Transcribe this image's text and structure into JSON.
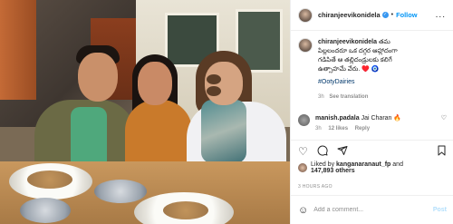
{
  "post": {
    "username": "chiranjeevikonidela",
    "follow_label": "Follow",
    "separator": "•",
    "more_label": "...",
    "caption": {
      "username": "chiranjeevikonidela",
      "line1": "తమ",
      "line2": "పిల్లలందరూ ఒక దగ్గర ఆహ్లాదంగా",
      "line3": "గడిపితే ఆ తల్లిదండ్రులకు కలిగే",
      "line4": "ఉత్సాహమే వేరు.",
      "emojis": "♥️ 🧿",
      "hashtag": "#OotyDairies",
      "time": "3h",
      "see_translation": "See translation"
    },
    "comment": {
      "username": "manish.padala",
      "text": "Jai Charan",
      "emoji": "🔥",
      "time": "3h",
      "likes": "12 likes",
      "reply": "Reply"
    },
    "icons": {
      "like": "heart-icon",
      "comment": "comment-icon",
      "share": "share-icon",
      "save": "bookmark-icon"
    },
    "liked_by": {
      "prefix": "Liked by",
      "user": "kanganaranaut_fp",
      "connector": "and",
      "count": "147,893 others"
    },
    "timestamp": "3 HOURS AGO",
    "add_comment": {
      "placeholder": "Add a comment...",
      "post_label": "Post"
    }
  },
  "colors": {
    "accent": "#0095f6",
    "verified": "#3897f0",
    "muted": "#8e8e8e",
    "post_disabled": "#b2dffc"
  }
}
